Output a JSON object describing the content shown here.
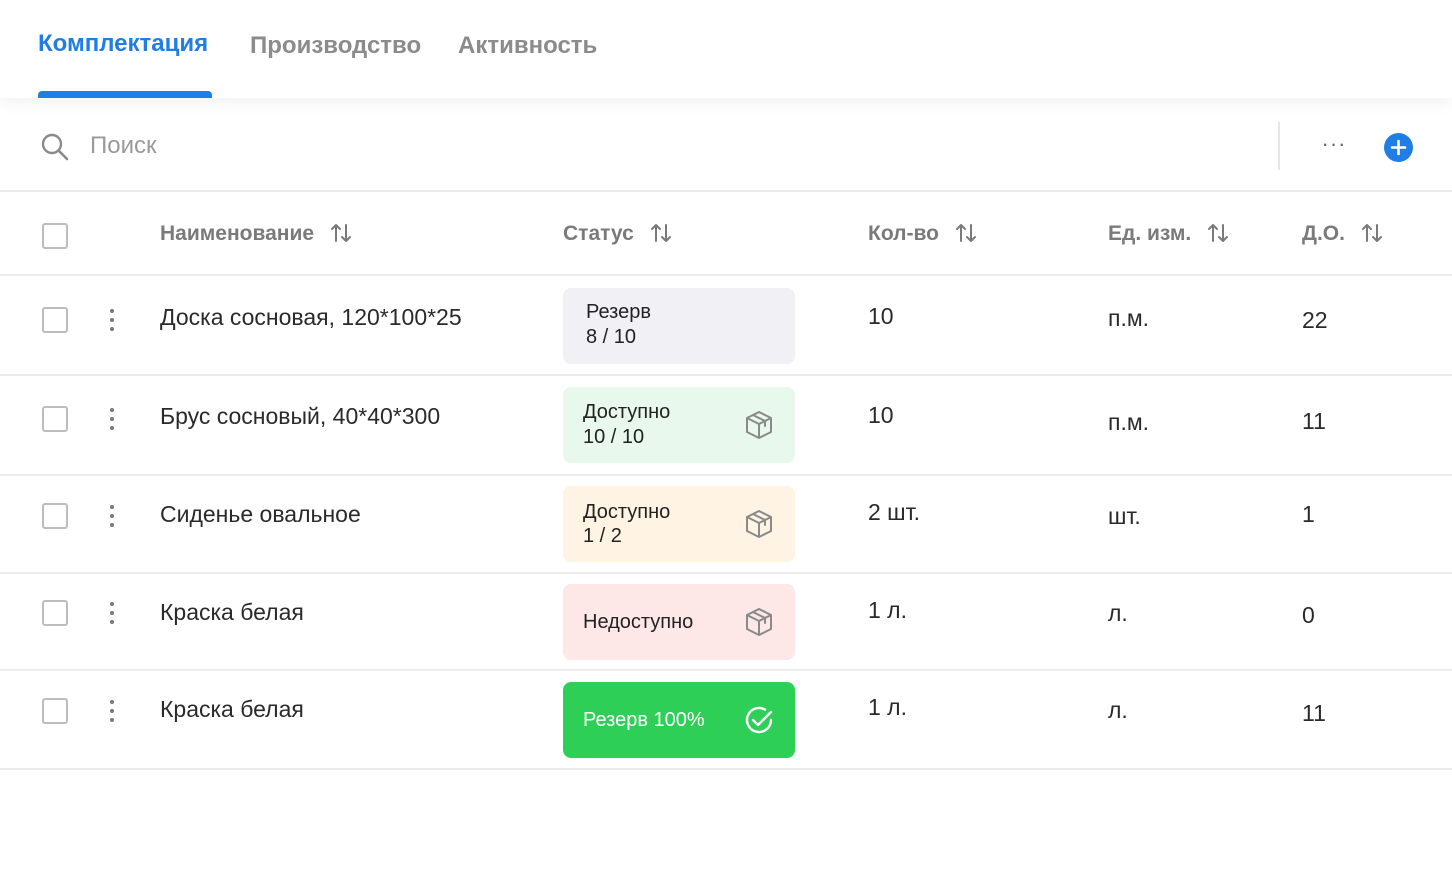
{
  "tabs": [
    {
      "label": "Комплектация",
      "active": true
    },
    {
      "label": "Производство",
      "active": false
    },
    {
      "label": "Активность",
      "active": false
    }
  ],
  "toolbar": {
    "search_placeholder": "Поиск",
    "more_label": "···",
    "search_icon": "search-icon",
    "add_icon": "plus-circle-icon"
  },
  "table": {
    "columns": [
      "Наименование",
      "Статус",
      "Кол-во",
      "Ед. изм.",
      "Д.О."
    ],
    "rows": [
      {
        "name": "Доска сосновая, 120*100*25",
        "status_title": "Резерв",
        "status_count": "8 / 10",
        "status_kind": "reserve",
        "qty": "10",
        "unit": "п.м.",
        "do": "22"
      },
      {
        "name": "Брус сосновый, 40*40*300",
        "status_title": "Доступно",
        "status_count": "10 / 10",
        "status_kind": "available-full",
        "qty": "10",
        "unit": "п.м.",
        "do": "11"
      },
      {
        "name": "Сиденье овальное",
        "status_title": "Доступно",
        "status_count": "1 / 2",
        "status_kind": "available-partial",
        "qty": "2 шт.",
        "unit": "шт.",
        "do": "1"
      },
      {
        "name": "Краска белая",
        "status_title": "Недоступно",
        "status_count": "",
        "status_kind": "unavailable",
        "qty": "1 л.",
        "unit": "л.",
        "do": "0"
      },
      {
        "name": "Краска белая",
        "status_title": "Резерв 100%",
        "status_count": "",
        "status_kind": "reserved-full",
        "qty": "1 л.",
        "unit": "л.",
        "do": "11"
      }
    ]
  },
  "colors": {
    "accent": "#1f7ee6",
    "reserve_bg": "#f1f1f5",
    "available_bg": "#e8f8ec",
    "partial_bg": "#fff4e3",
    "unavailable_bg": "#fde7e7",
    "reserved_full_bg": "#2ecf57"
  }
}
